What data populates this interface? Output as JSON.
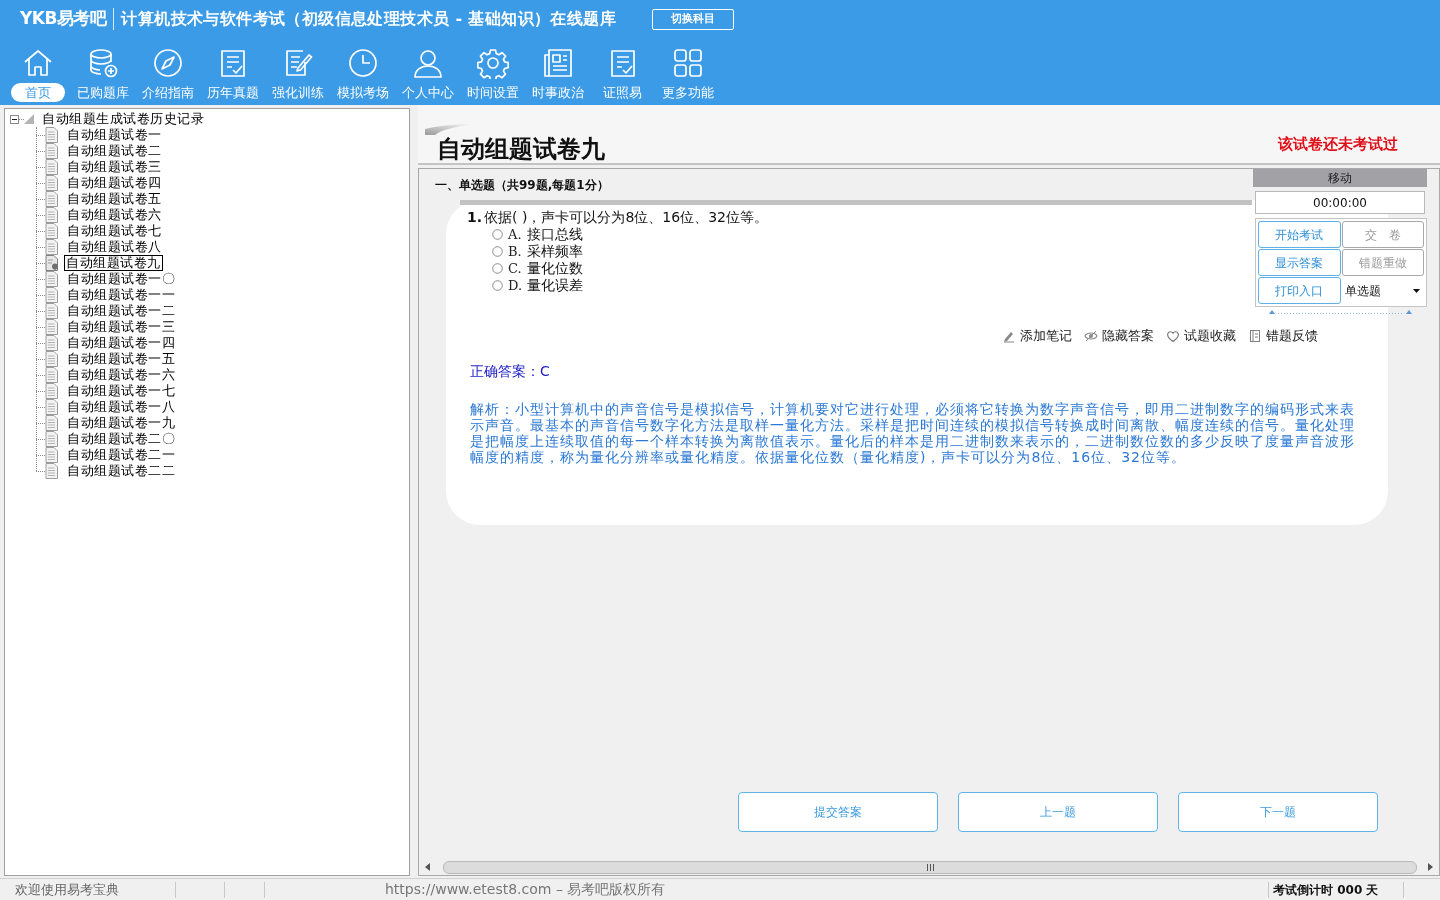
{
  "header": {
    "logo": "YKB易考吧",
    "title": "计算机技术与软件考试（初级信息处理技术员 - 基础知识）在线题库",
    "switch_button": "切换科目"
  },
  "toolbar": [
    {
      "kind": "home",
      "label": "首页",
      "selected": true
    },
    {
      "kind": "database",
      "label": "已购题库",
      "selected": false
    },
    {
      "kind": "compass",
      "label": "介绍指南",
      "selected": false
    },
    {
      "kind": "list",
      "label": "历年真题",
      "selected": false
    },
    {
      "kind": "edit",
      "label": "强化训练",
      "selected": false
    },
    {
      "kind": "clock",
      "label": "模拟考场",
      "selected": false
    },
    {
      "kind": "user",
      "label": "个人中心",
      "selected": false
    },
    {
      "kind": "gear",
      "label": "时间设置",
      "selected": false
    },
    {
      "kind": "news",
      "label": "时事政治",
      "selected": false
    },
    {
      "kind": "list",
      "label": "证照易",
      "selected": false
    },
    {
      "kind": "grid",
      "label": "更多功能",
      "selected": false
    }
  ],
  "tree": {
    "label": "自动组题生成试卷历史记录",
    "expanded": true,
    "children": [
      {
        "label": "自动组题试卷一",
        "selected": false
      },
      {
        "label": "自动组题试卷二",
        "selected": false
      },
      {
        "label": "自动组题试卷三",
        "selected": false
      },
      {
        "label": "自动组题试卷四",
        "selected": false
      },
      {
        "label": "自动组题试卷五",
        "selected": false
      },
      {
        "label": "自动组题试卷六",
        "selected": false
      },
      {
        "label": "自动组题试卷七",
        "selected": false
      },
      {
        "label": "自动组题试卷八",
        "selected": false
      },
      {
        "label": "自动组题试卷九",
        "selected": true
      },
      {
        "label": "自动组题试卷一〇",
        "selected": false
      },
      {
        "label": "自动组题试卷一一",
        "selected": false
      },
      {
        "label": "自动组题试卷一二",
        "selected": false
      },
      {
        "label": "自动组题试卷一三",
        "selected": false
      },
      {
        "label": "自动组题试卷一四",
        "selected": false
      },
      {
        "label": "自动组题试卷一五",
        "selected": false
      },
      {
        "label": "自动组题试卷一六",
        "selected": false
      },
      {
        "label": "自动组题试卷一七",
        "selected": false
      },
      {
        "label": "自动组题试卷一八",
        "selected": false
      },
      {
        "label": "自动组题试卷一九",
        "selected": false
      },
      {
        "label": "自动组题试卷二〇",
        "selected": false
      },
      {
        "label": "自动组题试卷二一",
        "selected": false
      },
      {
        "label": "自动组题试卷二二",
        "selected": false
      }
    ]
  },
  "paper": {
    "title": "自动组题试卷九",
    "status": "该试卷还未考试过"
  },
  "section": "一、单选题（共99题,每题1分）",
  "question": {
    "number": "1.",
    "text": "依据( )，声卡可以分为8位、16位、32位等。",
    "options": [
      {
        "label": "A.",
        "text": "接口总线",
        "selected": false
      },
      {
        "label": "B.",
        "text": "采样频率",
        "selected": false
      },
      {
        "label": "C.",
        "text": "量化位数",
        "selected": false
      },
      {
        "label": "D.",
        "text": "量化误差",
        "selected": false
      }
    ]
  },
  "question_tools": [
    {
      "kind": "pencil",
      "label": "添加笔记"
    },
    {
      "kind": "eye",
      "label": "隐藏答案"
    },
    {
      "kind": "heart",
      "label": "试题收藏"
    },
    {
      "kind": "book",
      "label": "错题反馈"
    }
  ],
  "answer": "正确答案：C",
  "analysis": "解析：小型计算机中的声音信号是模拟信号，计算机要对它进行处理，必须将它转换为数字声音信号，即用二进制数字的编码形式来表示声音。最基本的声音信号数字化方法是取样一量化方法。采样是把时间连续的模拟信号转换成时间离散、幅度连续的信号。量化处理是把幅度上连续取值的每一个样本转换为离散值表示。量化后的样本是用二进制数来表示的，二进制数位数的多少反映了度量声音波形幅度的精度，称为量化分辨率或量化精度。依据量化位数（量化精度)，声卡可以分为8位、16位、32位等。",
  "side_panel": {
    "title": "移动",
    "timer": "00:00:00",
    "buttons": [
      {
        "label": "开始考试",
        "disabled": false
      },
      {
        "label": "交　卷",
        "disabled": true
      },
      {
        "label": "显示答案",
        "disabled": false
      },
      {
        "label": "错题重做",
        "disabled": true
      },
      {
        "label": "打印入口",
        "disabled": false
      }
    ],
    "question_type": "单选题"
  },
  "nav_buttons": [
    "提交答案",
    "上一题",
    "下一题"
  ],
  "status_bar": {
    "welcome": "欢迎使用易考宝典",
    "copyright": "https://www.etest8.com – 易考吧版权所有",
    "countdown": "考试倒计时 000 天"
  }
}
